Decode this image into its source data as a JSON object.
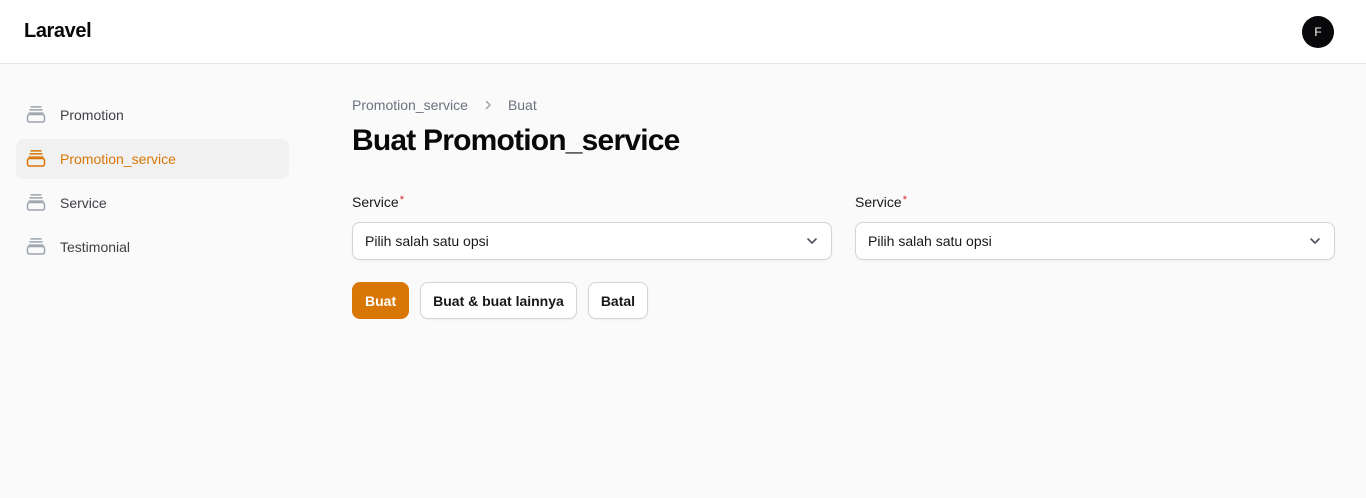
{
  "header": {
    "brand": "Laravel",
    "user_initial": "F"
  },
  "sidebar": {
    "items": [
      {
        "label": "Promotion",
        "icon": "stack-icon",
        "active": false
      },
      {
        "label": "Promotion_service",
        "icon": "stack-icon",
        "active": true
      },
      {
        "label": "Service",
        "icon": "stack-icon",
        "active": false
      },
      {
        "label": "Testimonial",
        "icon": "stack-icon",
        "active": false
      }
    ]
  },
  "breadcrumb": {
    "items": [
      "Promotion_service",
      "Buat"
    ]
  },
  "page": {
    "title": "Buat Promotion_service"
  },
  "form": {
    "fields": [
      {
        "label": "Service",
        "required_mark": "*",
        "value": "Pilih salah satu opsi"
      },
      {
        "label": "Service",
        "required_mark": "*",
        "value": "Pilih salah satu opsi"
      }
    ]
  },
  "actions": {
    "create": "Buat",
    "create_another": "Buat & buat lainnya",
    "cancel": "Batal"
  },
  "colors": {
    "accent": "#d97706",
    "avatar_bg": "#09090b",
    "required": "#dc2626"
  }
}
